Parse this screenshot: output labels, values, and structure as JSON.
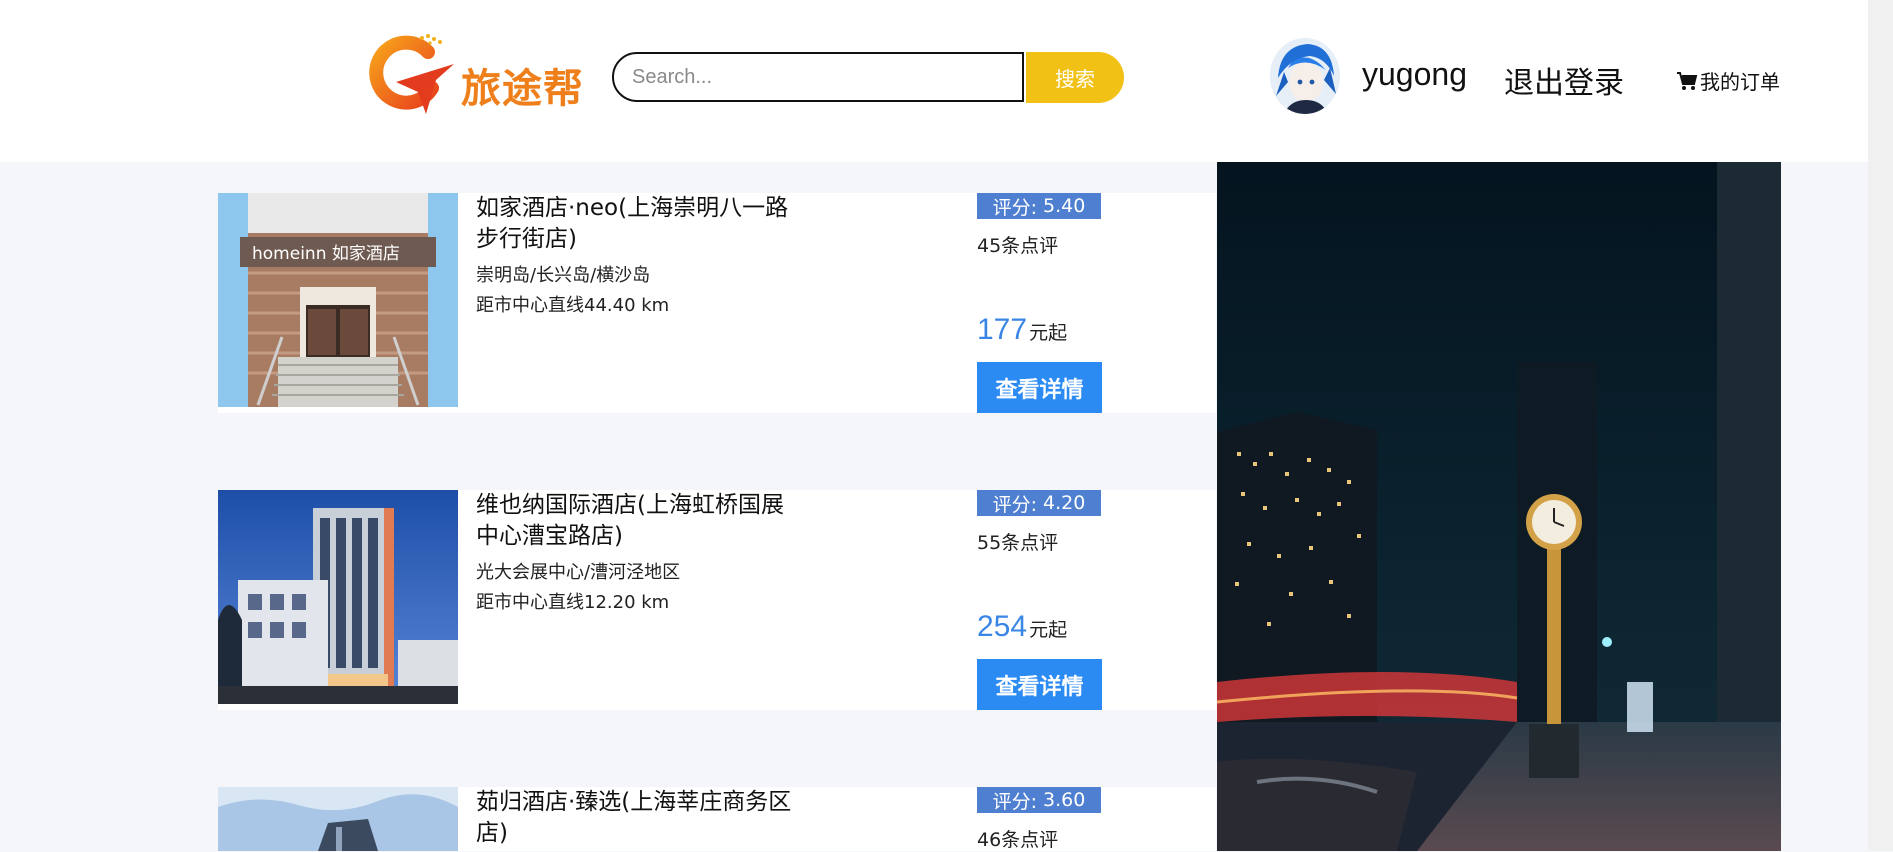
{
  "header": {
    "logo_text": "旅途帮",
    "search": {
      "placeholder": "Search...",
      "value": "",
      "button_label": "搜索"
    },
    "user": {
      "username": "yugong",
      "logout_label": "退出登录",
      "orders_label": "我的订单"
    }
  },
  "hotels": [
    {
      "name": "如家酒店·neo(上海崇明八一路步行街店)",
      "area": "崇明岛/长兴岛/横沙岛",
      "distance": "距市中心直线44.40 km",
      "rating_label": "评分:",
      "rating": "5.40",
      "reviews": "45条点评",
      "price": "177",
      "price_suffix": "元起",
      "detail_label": "查看详情"
    },
    {
      "name": "维也纳国际酒店(上海虹桥国展中心漕宝路店)",
      "area": "光大会展中心/漕河泾地区",
      "distance": "距市中心直线12.20 km",
      "rating_label": "评分:",
      "rating": "4.20",
      "reviews": "55条点评",
      "price": "254",
      "price_suffix": "元起",
      "detail_label": "查看详情"
    },
    {
      "name": "茹归酒店·臻选(上海莘庄商务区店)",
      "area": "",
      "distance": "",
      "rating_label": "评分:",
      "rating": "3.60",
      "reviews": "46条点评",
      "price": "",
      "price_suffix": "",
      "detail_label": ""
    }
  ],
  "icons": {
    "logo": "plane-q-logo-icon",
    "cart": "cart-icon",
    "avatar": "user-avatar"
  },
  "colors": {
    "logo": "#ef7f1a",
    "search_button": "#f2c116",
    "rating_badge": "#4f7fd0",
    "price": "#3a86e6",
    "detail_button": "#2c8bf3",
    "background": "#f4f6fa"
  }
}
